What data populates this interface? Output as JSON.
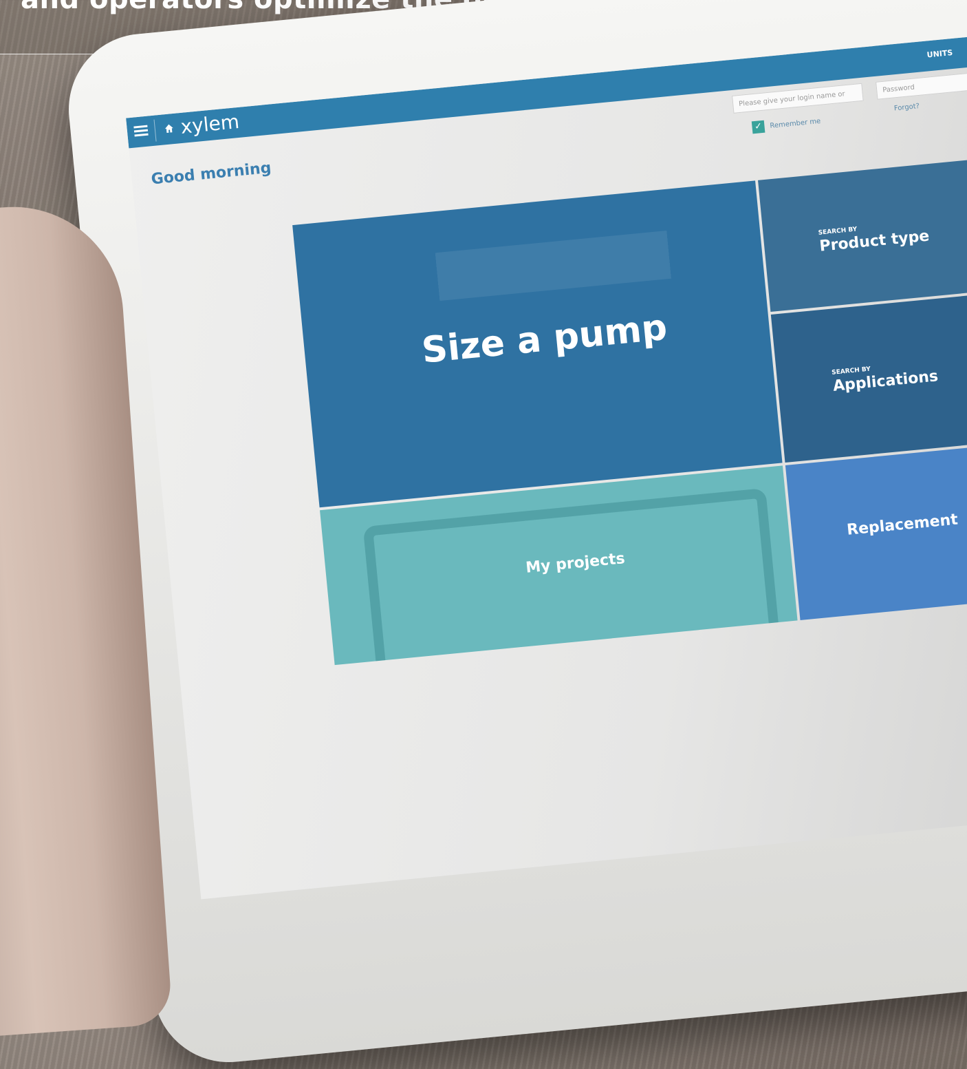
{
  "headline": "and operators optimize the design of their stations.",
  "app": {
    "brand": "xylem",
    "units_label": "UNITS",
    "greeting": "Good morning"
  },
  "login": {
    "name_placeholder": "Please give your login name or",
    "password_placeholder": "Password",
    "remember_label": "Remember me",
    "forgot_label": "Forgot?"
  },
  "tiles": {
    "size_pump": {
      "title": "Size a pump"
    },
    "product_type": {
      "kicker": "SEARCH BY",
      "title": "Product type"
    },
    "applications": {
      "kicker": "SEARCH BY",
      "title": "Applications"
    },
    "my_projects": {
      "title": "My projects"
    },
    "replacement": {
      "title": "Replacement"
    }
  },
  "colors": {
    "brand_blue": "#2f7fad",
    "tile_blue": "#2f72a2",
    "tile_teal": "#6ab9bd",
    "tile_light_blue": "#4a84c7",
    "check_green": "#3aa39b"
  }
}
